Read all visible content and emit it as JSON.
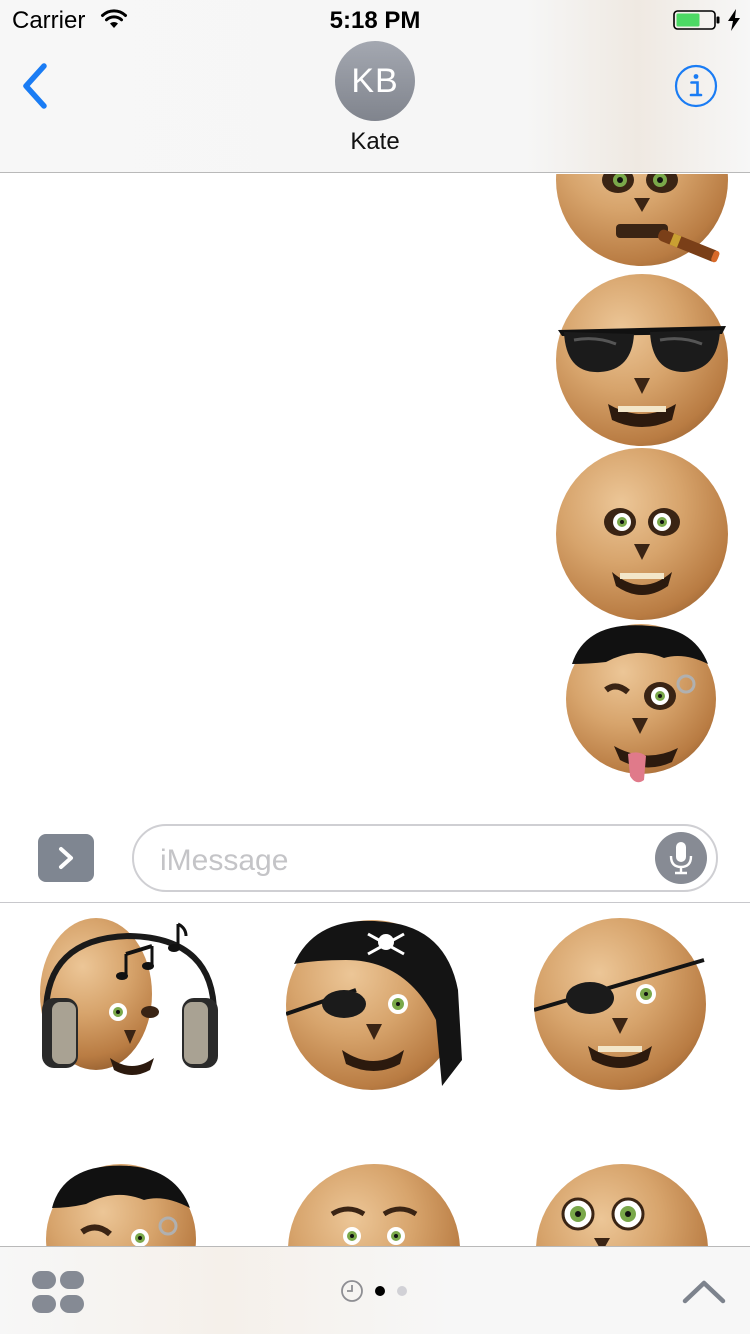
{
  "status_bar": {
    "carrier": "Carrier",
    "time": "5:18 PM"
  },
  "header": {
    "avatar_initials": "KB",
    "contact_name": "Kate"
  },
  "input": {
    "placeholder": "iMessage"
  },
  "colors": {
    "accent": "#1a7cf4",
    "battery": "#4cd964",
    "avatar": "#8e929b"
  },
  "sent_stickers": [
    {
      "name": "skull-smoking-cigar"
    },
    {
      "name": "skull-sunglasses"
    },
    {
      "name": "skull-surprised"
    },
    {
      "name": "skull-punk-tongue"
    }
  ],
  "drawer_stickers": [
    {
      "name": "skull-headphones"
    },
    {
      "name": "skull-pirate-bandana"
    },
    {
      "name": "skull-eyepatch"
    },
    {
      "name": "skull-punk"
    },
    {
      "name": "skull-worried"
    },
    {
      "name": "skull-staring"
    }
  ],
  "page_indicator": {
    "pages": 2,
    "current": 1
  }
}
